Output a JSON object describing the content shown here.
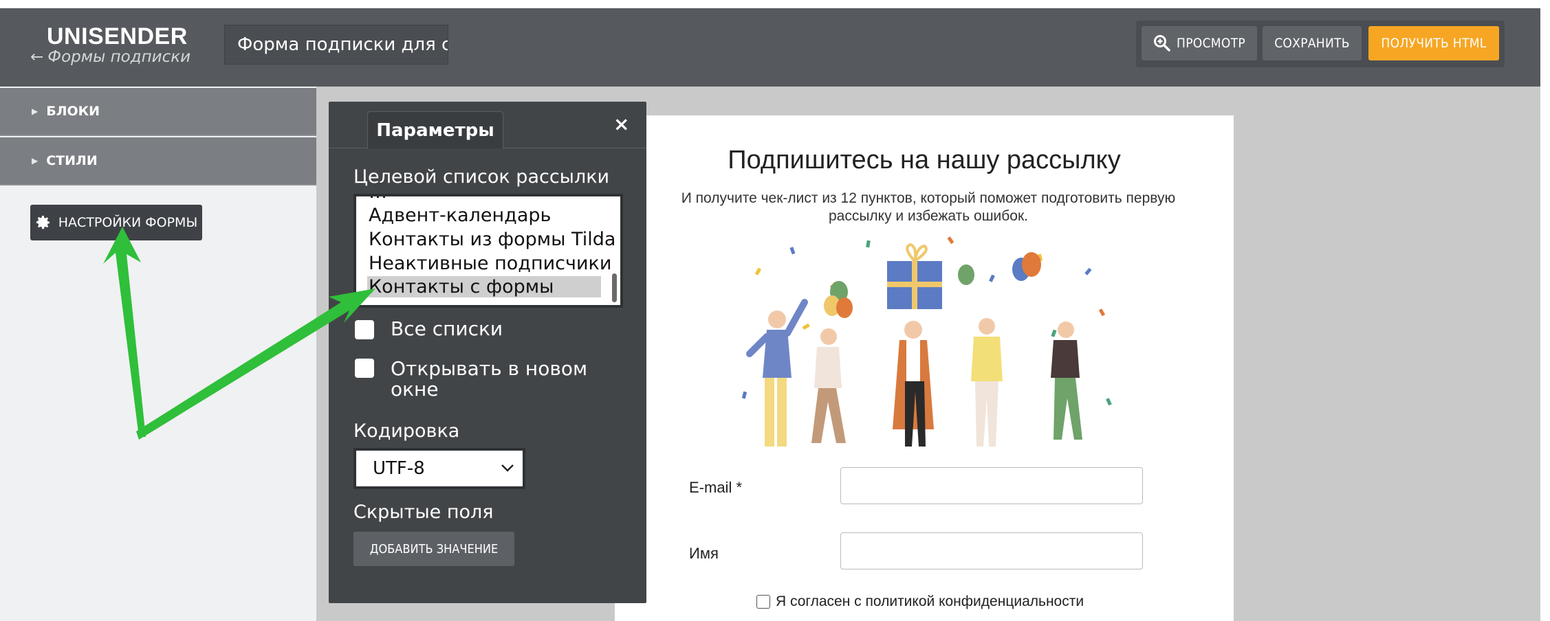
{
  "header": {
    "logo": "UNISENDER",
    "back_link": "Формы подписки",
    "form_title": "Форма подписки для сайта",
    "buttons": {
      "preview": "ПРОСМОТР",
      "save": "СОХРАНИТЬ",
      "get_html": "ПОЛУЧИТЬ HTML"
    }
  },
  "sidebar": {
    "sections": [
      {
        "label": "БЛОКИ"
      },
      {
        "label": "СТИЛИ"
      }
    ],
    "form_settings_button": "НАСТРОЙКИ ФОРМЫ"
  },
  "params_panel": {
    "tab": "Параметры",
    "close": "×",
    "target_list_label": "Целевой список рассылки",
    "lists": [
      "Адвент-календарь",
      "Контакты из формы Tilda",
      "Неактивные подписчики",
      "Контакты с формы"
    ],
    "selected_list": "Контакты с формы",
    "all_lists_label": "Все списки",
    "open_new_window_label": "Открывать в новом окне",
    "encoding_label": "Кодировка",
    "encoding_value": "UTF-8",
    "hidden_fields_label": "Скрытые поля",
    "add_value_button": "ДОБАВИТЬ ЗНАЧЕНИЕ"
  },
  "form_preview": {
    "title": "Подпишитесь на нашу рассылку",
    "subtitle": "И получите чек-лист из 12 пунктов, который поможет подготовить первую рассылку и избежать ошибок.",
    "email_label": "E-mail *",
    "name_label": "Имя",
    "consent_label": "Я согласен с политикой конфиденциальности"
  },
  "colors": {
    "topbar": "#565a5e",
    "accent_orange": "#f6a623",
    "panel": "#424548",
    "arrow_green": "#2fbf3a"
  },
  "icons": [
    "back-arrow-icon",
    "zoom-icon",
    "gear-icon",
    "close-icon",
    "chevron-down-icon",
    "caret-right-icon"
  ]
}
